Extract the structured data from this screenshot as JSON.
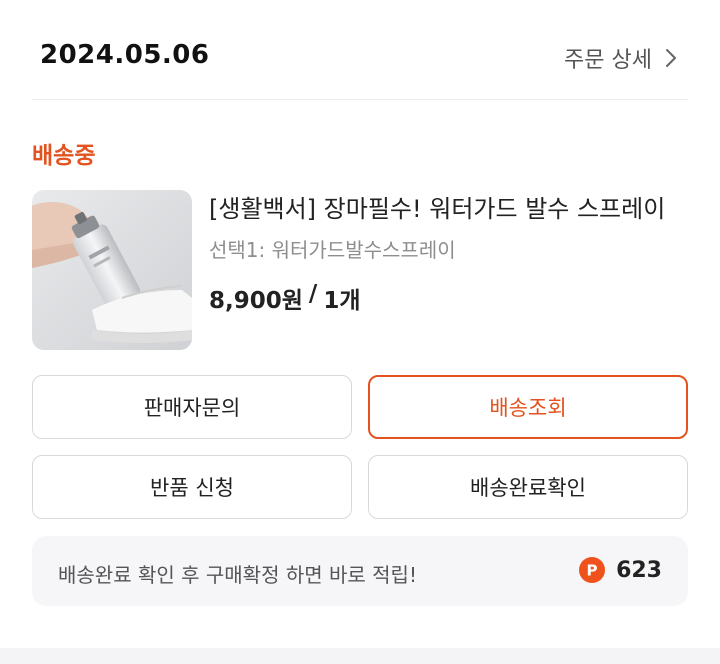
{
  "order": {
    "date": "2024.05.06",
    "detail_label": "주문 상세"
  },
  "status": {
    "label": "배송중",
    "color": "#e2531f"
  },
  "product": {
    "title": "[생활백서] 장마필수! 워터가드 발수 스프레이",
    "option": "선택1: 워터가드발수스프레이",
    "price": "8,900원",
    "separator": "/",
    "quantity": "1개"
  },
  "actions": {
    "seller_inquiry": "판매자문의",
    "track_delivery": "배송조회",
    "return_request": "반품 신청",
    "confirm_delivery": "배송완료확인"
  },
  "points": {
    "message": "배송완료 확인 후 구매확정 하면 바로 적립!",
    "icon_letter": "P",
    "value": "623"
  },
  "icons": {
    "detail": "chevron-right-icon",
    "points": "points-coin-icon"
  }
}
